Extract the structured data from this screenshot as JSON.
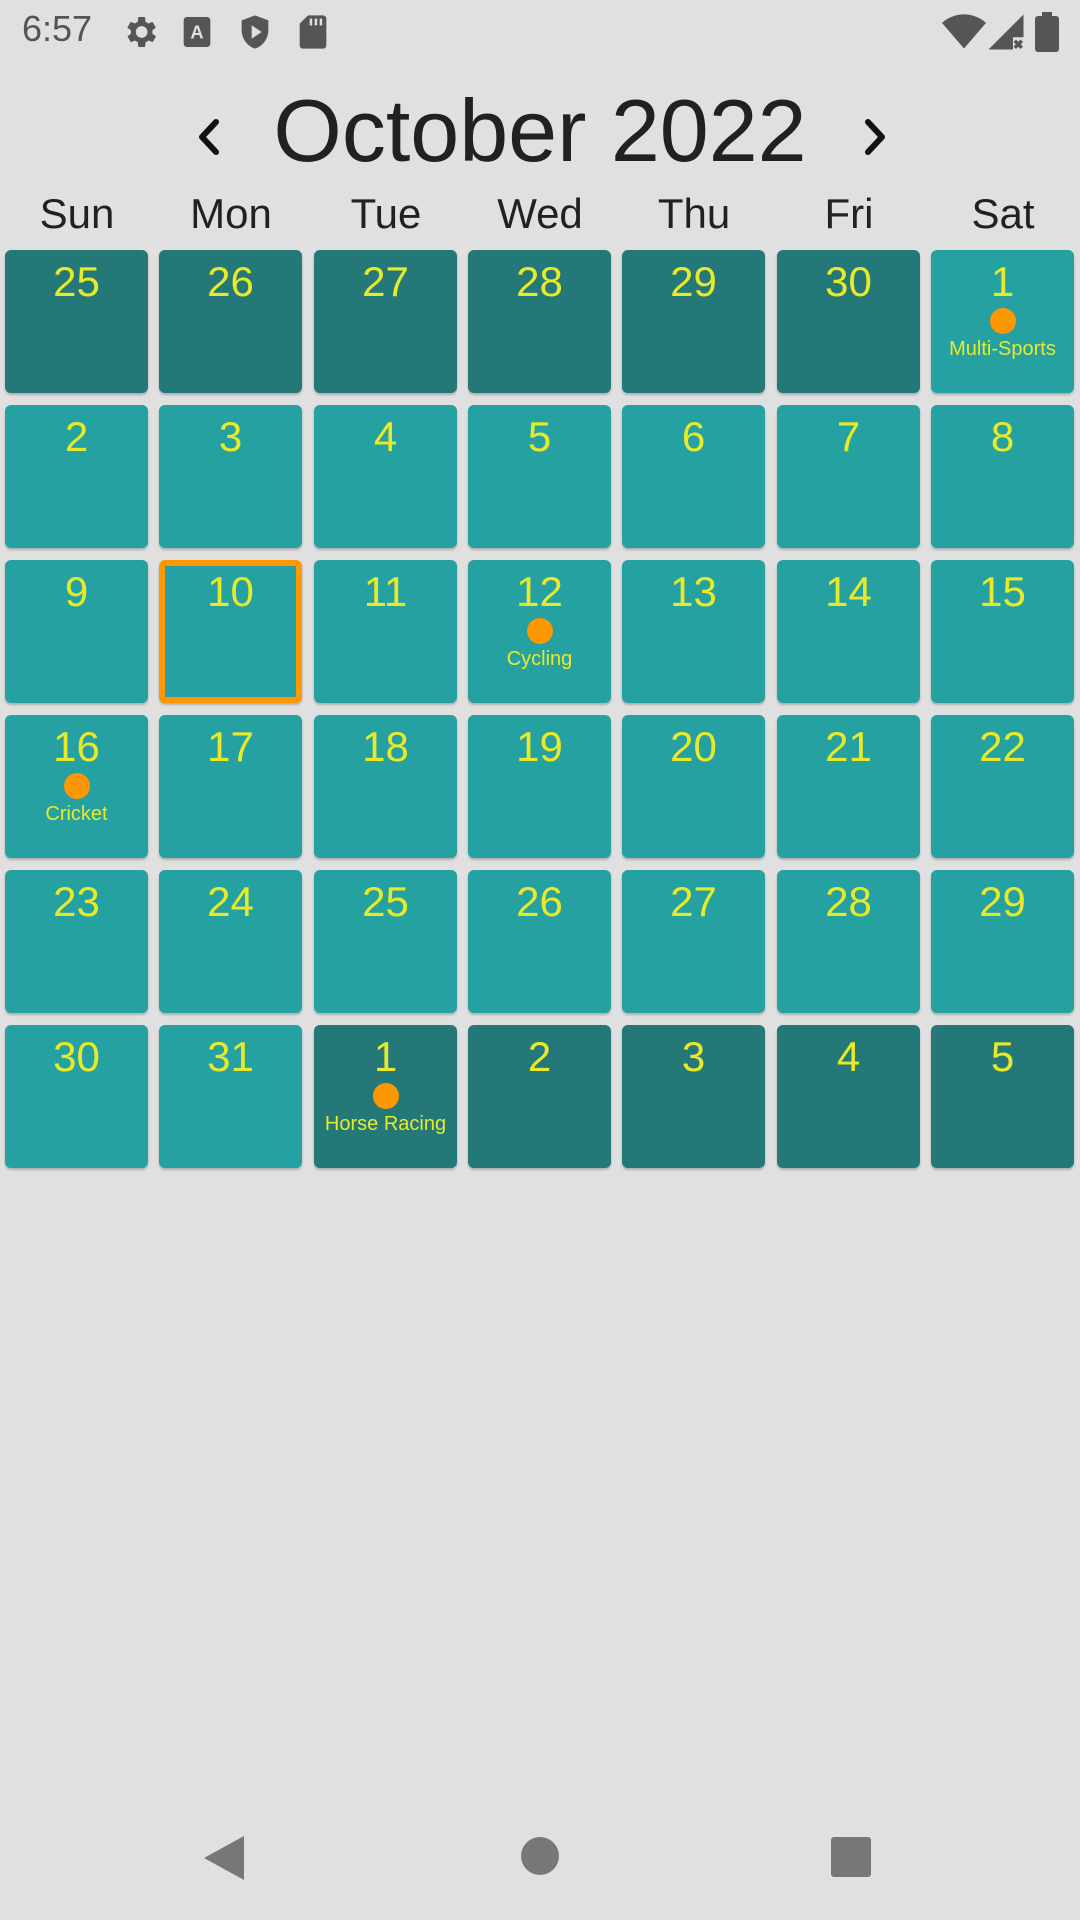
{
  "status_bar": {
    "time": "6:57",
    "left_icons": [
      "settings-icon",
      "keyboard-a-icon",
      "play-shield-icon",
      "sd-card-icon"
    ],
    "right_icons": [
      "wifi-icon",
      "signal-icon",
      "battery-icon"
    ]
  },
  "header": {
    "title": "October 2022",
    "prev_icon": "chevron-left-icon",
    "next_icon": "chevron-right-icon"
  },
  "weekdays": [
    "Sun",
    "Mon",
    "Tue",
    "Wed",
    "Thu",
    "Fri",
    "Sat"
  ],
  "calendar": {
    "colors": {
      "current_month_cell": "#26a1a1",
      "other_month_cell": "#247878",
      "day_number": "#e8ea29",
      "event_dot": "#ff9800",
      "today_border": "#ff9800"
    },
    "days": [
      {
        "d": "25",
        "cur": false
      },
      {
        "d": "26",
        "cur": false
      },
      {
        "d": "27",
        "cur": false
      },
      {
        "d": "28",
        "cur": false
      },
      {
        "d": "29",
        "cur": false
      },
      {
        "d": "30",
        "cur": false
      },
      {
        "d": "1",
        "cur": true,
        "event": "Multi-Sports"
      },
      {
        "d": "2",
        "cur": true
      },
      {
        "d": "3",
        "cur": true
      },
      {
        "d": "4",
        "cur": true
      },
      {
        "d": "5",
        "cur": true
      },
      {
        "d": "6",
        "cur": true
      },
      {
        "d": "7",
        "cur": true
      },
      {
        "d": "8",
        "cur": true
      },
      {
        "d": "9",
        "cur": true
      },
      {
        "d": "10",
        "cur": true,
        "today": true
      },
      {
        "d": "11",
        "cur": true
      },
      {
        "d": "12",
        "cur": true,
        "event": "Cycling"
      },
      {
        "d": "13",
        "cur": true
      },
      {
        "d": "14",
        "cur": true
      },
      {
        "d": "15",
        "cur": true
      },
      {
        "d": "16",
        "cur": true,
        "event": "Cricket"
      },
      {
        "d": "17",
        "cur": true
      },
      {
        "d": "18",
        "cur": true
      },
      {
        "d": "19",
        "cur": true
      },
      {
        "d": "20",
        "cur": true
      },
      {
        "d": "21",
        "cur": true
      },
      {
        "d": "22",
        "cur": true
      },
      {
        "d": "23",
        "cur": true
      },
      {
        "d": "24",
        "cur": true
      },
      {
        "d": "25",
        "cur": true
      },
      {
        "d": "26",
        "cur": true
      },
      {
        "d": "27",
        "cur": true
      },
      {
        "d": "28",
        "cur": true
      },
      {
        "d": "29",
        "cur": true
      },
      {
        "d": "30",
        "cur": true
      },
      {
        "d": "31",
        "cur": true
      },
      {
        "d": "1",
        "cur": false,
        "event": "Horse Racing"
      },
      {
        "d": "2",
        "cur": false
      },
      {
        "d": "3",
        "cur": false
      },
      {
        "d": "4",
        "cur": false
      },
      {
        "d": "5",
        "cur": false
      }
    ]
  },
  "nav_bar": {
    "back_icon": "back-triangle-icon",
    "home_icon": "home-circle-icon",
    "recents_icon": "recents-square-icon"
  }
}
